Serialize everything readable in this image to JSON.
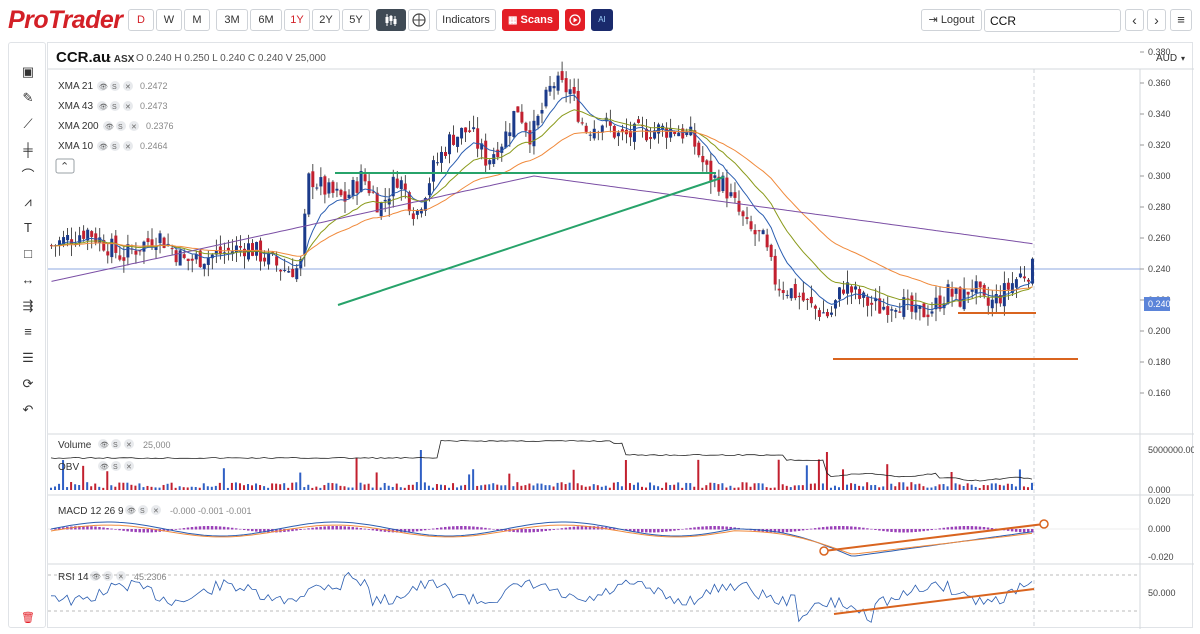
{
  "app": {
    "logo": "ProTrader"
  },
  "toolbar": {
    "intervals": [
      "D",
      "W",
      "M"
    ],
    "ranges": [
      "3M",
      "6M",
      "1Y",
      "2Y",
      "5Y"
    ],
    "active_range": "1Y",
    "indicators_label": "Indicators",
    "scans_label": "Scans",
    "ai_label": "AI",
    "logout_label": "Logout",
    "search_value": "CCR",
    "prev_label": "‹",
    "next_label": "›",
    "menu_label": "≡"
  },
  "chart_header": {
    "symbol": "CCR.au",
    "exchange": ": ASX",
    "ohlcv": "O 0.240  H 0.250  L 0.240  C 0.240  V 25,000",
    "currency": "AUD"
  },
  "legend": [
    {
      "name": "XMA 21",
      "value": "0.2472",
      "color": "#8a9a1b"
    },
    {
      "name": "XMA 43",
      "value": "0.2473",
      "color": "#f08a3c"
    },
    {
      "name": "XMA 200",
      "value": "0.2376",
      "color": "#7b4fa5"
    },
    {
      "name": "XMA 10",
      "value": "0.2464",
      "color": "#2a5db0"
    }
  ],
  "legend_icons": {
    "eye": "👁",
    "s": "S",
    "x": "✕"
  },
  "collapse_label": "⌃",
  "price_axis": {
    "ticks": [
      "0.380",
      "0.360",
      "0.340",
      "0.320",
      "0.300",
      "0.280",
      "0.260",
      "0.240",
      "0.220",
      "0.200",
      "0.180",
      "0.160"
    ],
    "current": "0.240"
  },
  "volume_panel": {
    "label": "Volume",
    "value": "25,000",
    "obv_label": "OBV",
    "ticks": [
      "5000000.00",
      "0.000"
    ]
  },
  "macd_panel": {
    "label": "MACD 12 26 9",
    "values": "-0.000  -0.001  -0.001",
    "ticks": [
      "0.020",
      "0.000",
      "-0.020"
    ]
  },
  "rsi_panel": {
    "label": "RSI 14",
    "value": "45.2306",
    "ticks": [
      "50.000"
    ]
  },
  "colors": {
    "up": "#1b3a8a",
    "down": "#c2202f",
    "xma21": "#8a9a1b",
    "xma43": "#f08a3c",
    "xma200": "#7b4fa5",
    "xma10": "#2a5db0",
    "trend_green": "#27a36a",
    "trend_orange": "#d9641f",
    "price_line": "#8fa9e0",
    "accent_red": "#e31e26"
  },
  "sidebar_tools": [
    "chart-type-icon",
    "ruler-icon",
    "trendline-icon",
    "horizontal-line-icon",
    "fibonacci-icon",
    "pattern-icon",
    "text-icon",
    "rectangle-icon",
    "arrow-line-icon",
    "channel-icon",
    "gann-icon",
    "levels-icon",
    "magnet-icon",
    "undo-icon"
  ],
  "sidebar_glyphs": [
    "▣",
    "✎",
    "⟋",
    "╪",
    "⌒",
    "⩘",
    "T",
    "□",
    "↔",
    "⇶",
    "≡",
    "☰",
    "⟳",
    "↶"
  ],
  "trash_glyph": "🗑"
}
